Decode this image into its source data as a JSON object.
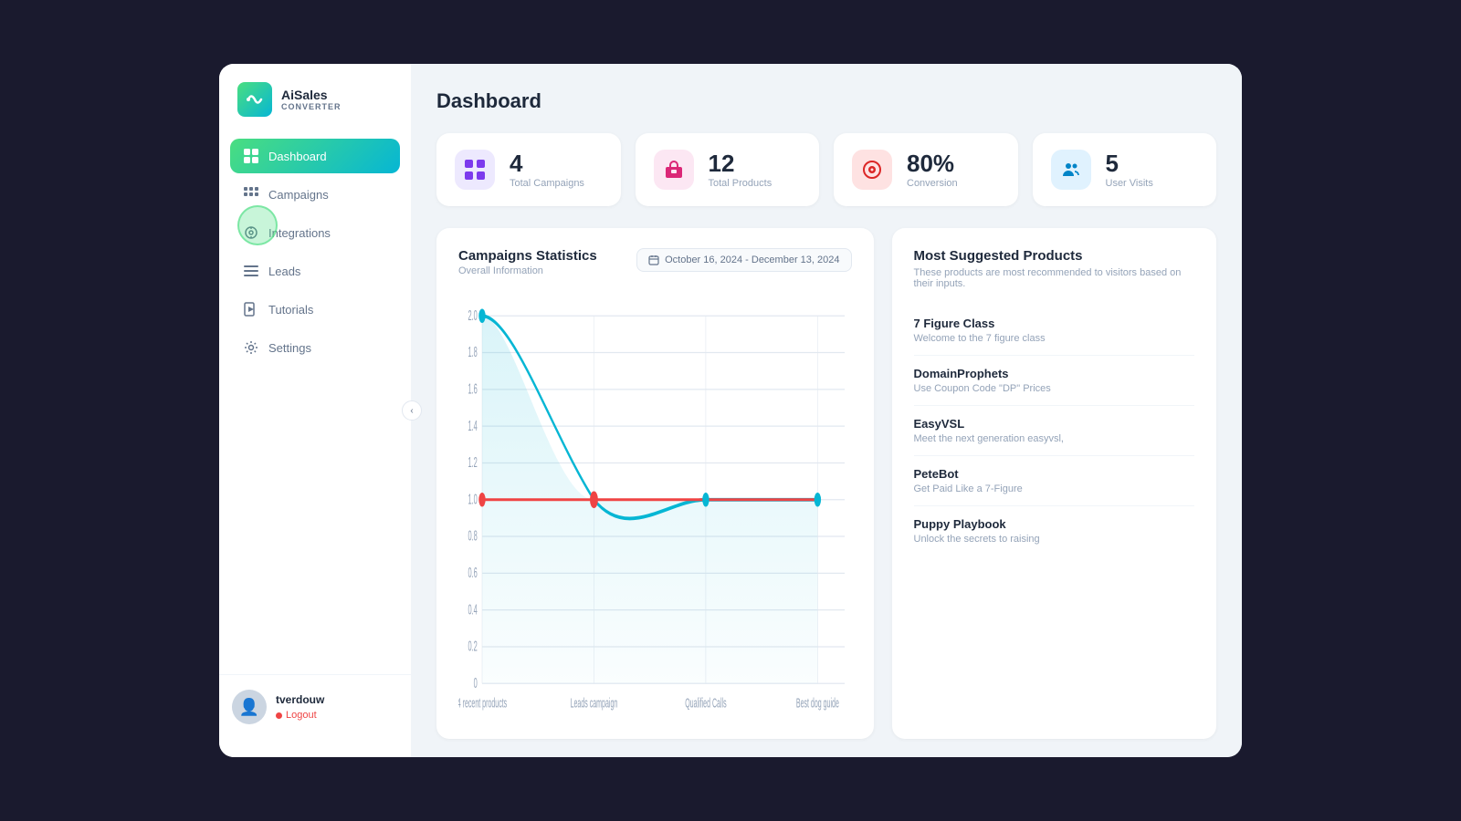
{
  "app": {
    "name": "AiSales",
    "sub": "CONVERTER"
  },
  "page": {
    "title": "Dashboard"
  },
  "nav": {
    "items": [
      {
        "id": "dashboard",
        "label": "Dashboard",
        "icon": "⊞",
        "active": true
      },
      {
        "id": "campaigns",
        "label": "Campaigns",
        "icon": "⊟",
        "active": false
      },
      {
        "id": "integrations",
        "label": "Integrations",
        "icon": "⚙",
        "active": false
      },
      {
        "id": "leads",
        "label": "Leads",
        "icon": "☰",
        "active": false
      },
      {
        "id": "tutorials",
        "label": "Tutorials",
        "icon": "▶",
        "active": false
      },
      {
        "id": "settings",
        "label": "Settings",
        "icon": "⚙",
        "active": false
      }
    ]
  },
  "user": {
    "name": "tverdouw",
    "logout_label": "Logout"
  },
  "stats": [
    {
      "id": "campaigns",
      "value": "4",
      "label": "Total Campaigns",
      "icon": "⊞",
      "icon_class": "campaigns"
    },
    {
      "id": "products",
      "value": "12",
      "label": "Total Products",
      "icon": "📦",
      "icon_class": "products"
    },
    {
      "id": "conversion",
      "value": "80%",
      "label": "Conversion",
      "icon": "🎯",
      "icon_class": "conversion"
    },
    {
      "id": "visits",
      "value": "5",
      "label": "User Visits",
      "icon": "👥",
      "icon_class": "visits"
    }
  ],
  "chart": {
    "title": "Campaigns Statistics",
    "subtitle": "Overall Information",
    "date_range": "October 16, 2024 - December 13, 2024",
    "x_labels": [
      "4 recent products",
      "Leads campaign",
      "Qualified Calls",
      "Best dog guide"
    ],
    "y_labels": [
      "0",
      "0.2",
      "0.4",
      "0.6",
      "0.8",
      "1.0",
      "1.2",
      "1.4",
      "1.6",
      "1.8",
      "2.0"
    ]
  },
  "products": {
    "title": "Most Suggested Products",
    "subtitle": "These products are most recommended to visitors based on their inputs.",
    "items": [
      {
        "name": "7 Figure Class",
        "desc": "Welcome to the 7 figure class"
      },
      {
        "name": "DomainProphets",
        "desc": "Use Coupon Code \"DP\" Prices"
      },
      {
        "name": "EasyVSL",
        "desc": "Meet the next generation easyvsl,"
      },
      {
        "name": "PeteBot",
        "desc": "Get Paid Like a 7-Figure"
      },
      {
        "name": "Puppy Playbook",
        "desc": "Unlock the secrets to raising"
      }
    ]
  }
}
